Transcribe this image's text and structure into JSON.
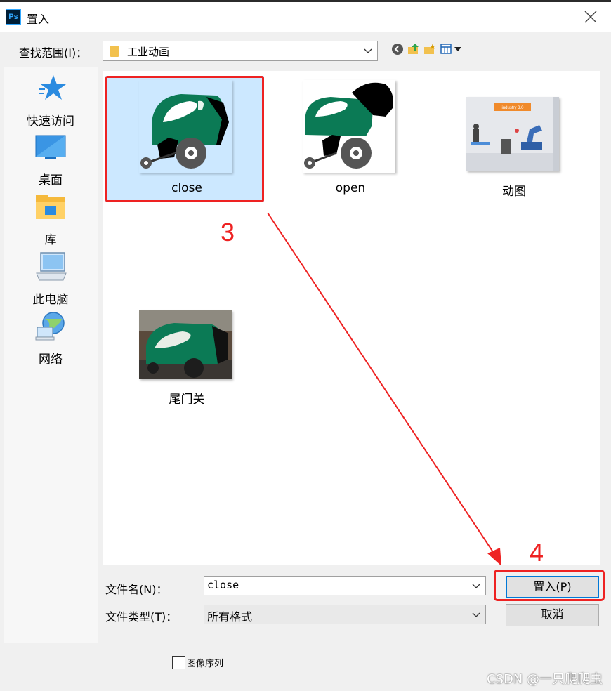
{
  "window": {
    "title": "置入",
    "app_icon_text": "Ps",
    "close_icon": "close-icon"
  },
  "lookin": {
    "label": "查找范围(I)：",
    "value": "工业动画"
  },
  "toolbar": {
    "icons": [
      "back-icon",
      "up-folder-icon",
      "new-folder-icon",
      "view-menu-icon"
    ]
  },
  "places": [
    {
      "label": "快速访问",
      "icon": "star-icon"
    },
    {
      "label": "桌面",
      "icon": "desktop-icon"
    },
    {
      "label": "库",
      "icon": "library-icon"
    },
    {
      "label": "此电脑",
      "icon": "computer-icon"
    },
    {
      "label": "网络",
      "icon": "network-icon"
    }
  ],
  "files": [
    {
      "name": "close",
      "selected": true
    },
    {
      "name": "open",
      "selected": false
    },
    {
      "name": "动图",
      "selected": false,
      "thumb_text": "industry 3.0"
    },
    {
      "name": "尾门关",
      "selected": false
    }
  ],
  "filename": {
    "label": "文件名(N)：",
    "value": "close"
  },
  "filetype": {
    "label": "文件类型(T)：",
    "value": "所有格式"
  },
  "buttons": {
    "open": "置入(P)",
    "cancel": "取消"
  },
  "sequence": {
    "label": "图像序列",
    "checked": false
  },
  "annotations": {
    "step3": "3",
    "step4": "4"
  },
  "watermark": "CSDN @一只爬爬虫",
  "colors": {
    "annotation": "#ee2222",
    "selection": "#cce8ff",
    "baler_green": "#0b7a55"
  }
}
